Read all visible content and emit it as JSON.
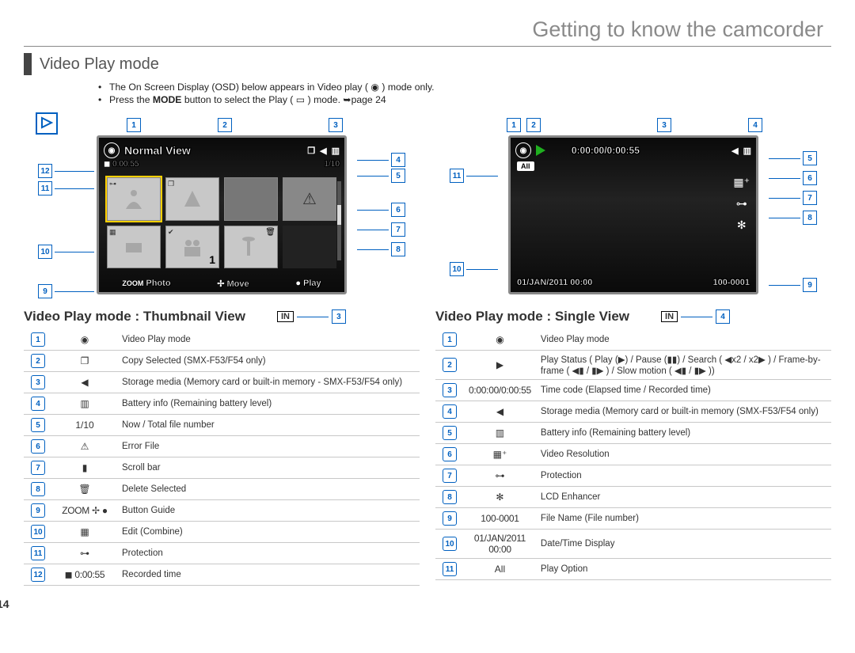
{
  "chapter_title": "Getting to know the camcorder",
  "section_title": "Video Play mode",
  "bullet1_a": "The On Screen Display (OSD) below appears in Video play (",
  "bullet1_b": ") mode only.",
  "bullet2_a": "Press the ",
  "bullet2_b": "MODE",
  "bullet2_c": " button to select the Play (",
  "bullet2_d": ") mode. ➥page 24",
  "page_number": "14",
  "left": {
    "title": "Video Play mode : Thumbnail View",
    "screen": {
      "normal_view": "Normal View",
      "recorded_time": "0:00:55",
      "file_count": "1/10",
      "thumb_one": "1",
      "ftr_zoom": "ZOOM",
      "ftr_photo": "Photo",
      "ftr_move": "Move",
      "ftr_play": "Play"
    },
    "badge": "IN",
    "badge_num": "3",
    "top_callouts": [
      "1",
      "2",
      "3"
    ],
    "right_callouts": [
      "4",
      "5",
      "6",
      "7",
      "8"
    ],
    "left_callouts_top": [
      "12",
      "11"
    ],
    "left_callouts_bot": [
      "10",
      "9"
    ],
    "legend": [
      {
        "n": "1",
        "ic": "◉",
        "d": "Video Play mode"
      },
      {
        "n": "2",
        "ic": "❐",
        "d": "Copy Selected (SMX-F53/F54 only)"
      },
      {
        "n": "3",
        "ic": "◀",
        "d": "Storage media (Memory card or built-in memory - SMX-F53/F54 only)"
      },
      {
        "n": "4",
        "ic": "▥",
        "d": "Battery info (Remaining battery level)"
      },
      {
        "n": "5",
        "ic": "1/10",
        "d": "Now / Total file number"
      },
      {
        "n": "6",
        "ic": "⚠",
        "d": "Error File"
      },
      {
        "n": "7",
        "ic": "▮",
        "d": "Scroll bar"
      },
      {
        "n": "8",
        "ic": "🗑",
        "d": "Delete Selected"
      },
      {
        "n": "9",
        "ic": "ZOOM ✢ ●",
        "d": "Button Guide"
      },
      {
        "n": "10",
        "ic": "▦",
        "d": "Edit (Combine)"
      },
      {
        "n": "11",
        "ic": "⊶",
        "d": "Protection"
      },
      {
        "n": "12",
        "ic": "◼ 0:00:55",
        "d": "Recorded time"
      }
    ]
  },
  "right": {
    "title": "Video Play mode : Single View",
    "screen": {
      "timecode": "0:00:00/0:00:55",
      "all": "All",
      "date": "01/JAN/2011 00:00",
      "file": "100-0001"
    },
    "badge": "IN",
    "badge_num": "4",
    "top_callouts": [
      "1",
      "2",
      "3",
      "4"
    ],
    "right_callouts": [
      "5",
      "6",
      "7",
      "8"
    ],
    "left_callouts": [
      "11"
    ],
    "bot_callouts_left": "10",
    "bot_callouts_right": "9",
    "legend": [
      {
        "n": "1",
        "ic": "◉",
        "d": "Video Play mode"
      },
      {
        "n": "2",
        "ic": "▶",
        "d": "Play Status ( Play (▶) / Pause (▮▮) / Search ( ◀x2 / x2▶ ) / Frame-by-frame ( ◀▮ / ▮▶ ) / Slow motion ( ◀▮ / ▮▶ ))"
      },
      {
        "n": "3",
        "ic": "0:00:00/0:00:55",
        "d": "Time code (Elapsed time / Recorded time)"
      },
      {
        "n": "4",
        "ic": "◀",
        "d": "Storage media (Memory card or built-in memory (SMX-F53/F54 only)"
      },
      {
        "n": "5",
        "ic": "▥",
        "d": "Battery info (Remaining battery level)"
      },
      {
        "n": "6",
        "ic": "▦⁺",
        "d": "Video Resolution"
      },
      {
        "n": "7",
        "ic": "⊶",
        "d": "Protection"
      },
      {
        "n": "8",
        "ic": "✻",
        "d": "LCD Enhancer"
      },
      {
        "n": "9",
        "ic": "100-0001",
        "d": "File Name (File number)"
      },
      {
        "n": "10",
        "ic": "01/JAN/2011 00:00",
        "d": "Date/Time Display"
      },
      {
        "n": "11",
        "ic": "All",
        "d": "Play Option"
      }
    ]
  }
}
